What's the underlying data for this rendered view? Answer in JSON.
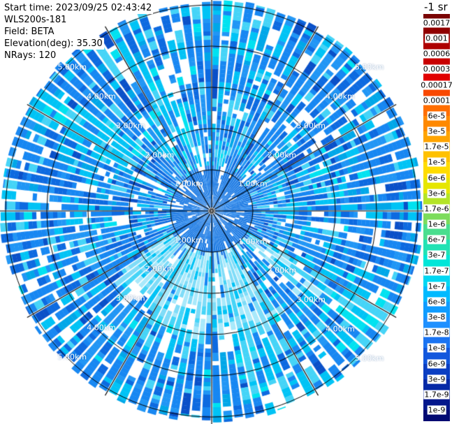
{
  "info": {
    "lines": [
      "Start time: 2023/09/25 02:43:42",
      "WLS200s-181",
      "Field: BETA",
      "Elevation(deg): 35.30",
      "NRays: 120"
    ]
  },
  "colorbar": {
    "title": "-1 sr"
  },
  "chart_data": {
    "type": "heatmap",
    "projection": "polar",
    "instrument": "WLS200s-181",
    "field": "BETA",
    "start_time": "2023/09/25 02:43:42",
    "elevation_deg": 35.3,
    "n_rays": 120,
    "ray_width_deg": 3,
    "spoke_interval_deg": 30,
    "range_rings_km": [
      1,
      2,
      3,
      4,
      5
    ],
    "ring_labels": [
      "1.00km",
      "2.00km",
      "3.00km",
      "4.00km",
      "5.00km"
    ],
    "max_range_km": 5.2,
    "scale": "log",
    "colorbar_title": "-1 sr",
    "colorbar_ticks": [
      "0.0017",
      "0.001",
      "0.0006",
      "0.0003",
      "0.00017",
      "0.0001",
      "6e-5",
      "3e-5",
      "1.7e-5",
      "1e-5",
      "6e-6",
      "3e-6",
      "1.7e-6",
      "1e-6",
      "6e-7",
      "3e-7",
      "1.7e-7",
      "1e-7",
      "6e-8",
      "3e-8",
      "1.7e-8",
      "1e-8",
      "6e-9",
      "3e-9",
      "1.7e-9",
      "1e-9"
    ],
    "colorbar_band_colors": [
      "#7a0403",
      "#900000",
      "#ae0000",
      "#c80000",
      "#e10000",
      "#f94902",
      "#ff6e00",
      "#ff8900",
      "#ffa400",
      "#ffc100",
      "#ffdc00",
      "#e6e600",
      "#b4e428",
      "#7cdc5c",
      "#4ade8e",
      "#22e2b4",
      "#00e6d8",
      "#00d7f2",
      "#00baff",
      "#0f9cff",
      "#1e90ff",
      "#1b74f2",
      "#1257dd",
      "#0b3ec2",
      "#0629a6",
      "#04178c",
      "#020a72"
    ],
    "value_summary": "Backscatter field dominated by values between 1e-8 and 3e-7 (blues and cyans) across all azimuths out to ~5.2 km",
    "data_palette": {
      "outer": [
        [
          "#1787f2",
          30
        ],
        [
          "#0d6ae0",
          16
        ],
        [
          "#2196f5",
          12
        ],
        [
          "#00c3f5",
          13
        ],
        [
          "#45d4f7",
          7
        ],
        [
          "#00a7e8",
          6
        ],
        [
          "#ffffff",
          9
        ],
        [
          "#0a50c8",
          4
        ],
        [
          "#00e2f0",
          3
        ]
      ],
      "inner": [
        [
          "#1b7ae4",
          84
        ],
        [
          "#ffffff",
          10
        ],
        [
          "#2d8cf0",
          6
        ]
      ],
      "cyan_patch": [
        [
          "#00c3f5",
          34
        ],
        [
          "#45d4f7",
          22
        ],
        [
          "#1787f2",
          18
        ],
        [
          "#00e2f0",
          10
        ],
        [
          "#ffffff",
          8
        ],
        [
          "#0d6ae0",
          8
        ]
      ],
      "light_south": [
        [
          "#7edcf8",
          30
        ],
        [
          "#a8e9fb",
          22
        ],
        [
          "#45d4f7",
          20
        ],
        [
          "#00c3f5",
          14
        ],
        [
          "#ffffff",
          8
        ],
        [
          "#1787f2",
          6
        ]
      ]
    },
    "render_seed": 20230925
  }
}
